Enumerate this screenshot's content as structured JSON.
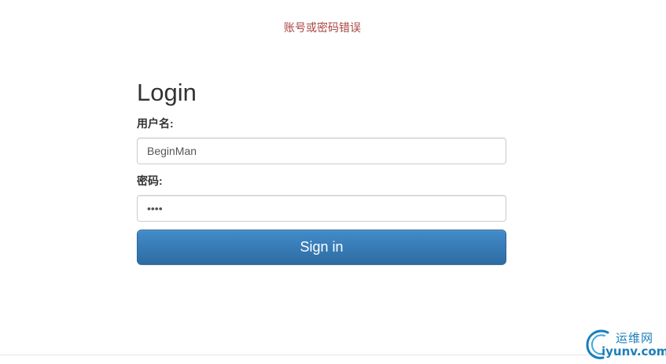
{
  "error": {
    "message": "账号或密码错误"
  },
  "login": {
    "title": "Login",
    "username_label": "用户名:",
    "username_value": "BeginMan",
    "password_label": "密码:",
    "password_value": "1234",
    "submit_label": "Sign in"
  },
  "watermark": {
    "cn_text": "运维网",
    "en_text": "iyunv.com",
    "color": "#1a7fb8"
  },
  "colors": {
    "error_text": "#a94442",
    "button_primary": "#337ab7"
  }
}
